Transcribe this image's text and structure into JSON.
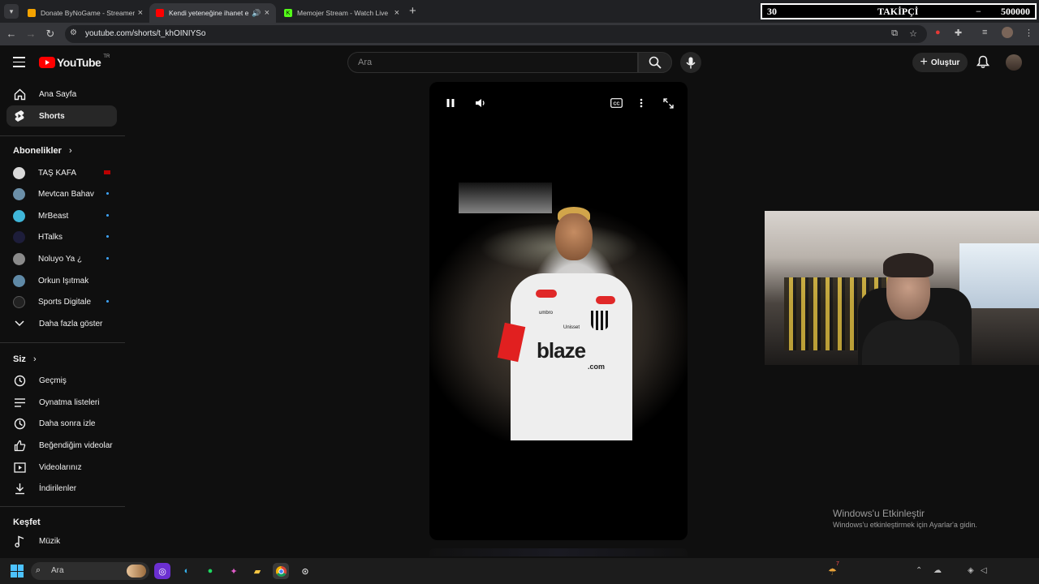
{
  "browser": {
    "tabs": [
      {
        "title": "Donate ByNoGame - Streamer",
        "active": false,
        "fav_color": "#f4a300"
      },
      {
        "title": "Kendi yeteneğine ihanet ed",
        "active": true,
        "fav_color": "#ff0000"
      },
      {
        "title": "Memojer Stream - Watch Live",
        "active": false,
        "fav_color": "#53fc18"
      }
    ],
    "url": "youtube.com/shorts/t_khOINIYSo"
  },
  "stream_overlay": {
    "count": "30",
    "label": "TAKİPÇİ",
    "dash": "−",
    "goal": "500000"
  },
  "youtube": {
    "logo_text": "YouTube",
    "country": "TR",
    "search_placeholder": "Ara",
    "create_label": "Oluştur",
    "nav": [
      {
        "label": "Ana Sayfa",
        "icon": "home-icon",
        "active": false
      },
      {
        "label": "Shorts",
        "icon": "shorts-icon",
        "active": true
      }
    ],
    "subs_title": "Abonelikler",
    "subscriptions": [
      {
        "name": "TAŞ KAFA",
        "color": "#d9d9d9",
        "status": "live"
      },
      {
        "name": "Mevtcan Bahav",
        "color": "#6b8fa8",
        "status": "new"
      },
      {
        "name": "MrBeast",
        "color": "#3fb6d9",
        "status": "new"
      },
      {
        "name": "HTalks",
        "color": "#1d1d3a",
        "status": "new"
      },
      {
        "name": "Noluyo Ya ¿",
        "color": "#8a8a8a",
        "status": "new"
      },
      {
        "name": "Orkun Işıtmak",
        "color": "#5f89a6",
        "status": ""
      },
      {
        "name": "Sports Digitale",
        "color": "#222222",
        "status": "new"
      }
    ],
    "more_label": "Daha fazla göster",
    "you_title": "Siz",
    "you_items": [
      {
        "label": "Geçmiş",
        "icon": "history-icon"
      },
      {
        "label": "Oynatma listeleri",
        "icon": "playlists-icon"
      },
      {
        "label": "Daha sonra izle",
        "icon": "watch-later-icon"
      },
      {
        "label": "Beğendiğim videolar",
        "icon": "liked-icon"
      },
      {
        "label": "Videolarınız",
        "icon": "your-videos-icon"
      },
      {
        "label": "İndirilenler",
        "icon": "downloads-icon"
      }
    ],
    "explore_title": "Keşfet",
    "explore_items": [
      {
        "label": "Müzik",
        "icon": "music-icon"
      }
    ]
  },
  "video": {
    "jersey_brand": "blaze",
    "jersey_brand_sub": ".com",
    "sponsor1": "umbro",
    "sponsor2": "Unisset"
  },
  "windows": {
    "activate_title": "Windows'u Etkinleştir",
    "activate_sub": "Windows'u etkinleştirmek için Ayarlar'a gidin.",
    "taskbar_search": "Ara",
    "notification_count": "7"
  }
}
